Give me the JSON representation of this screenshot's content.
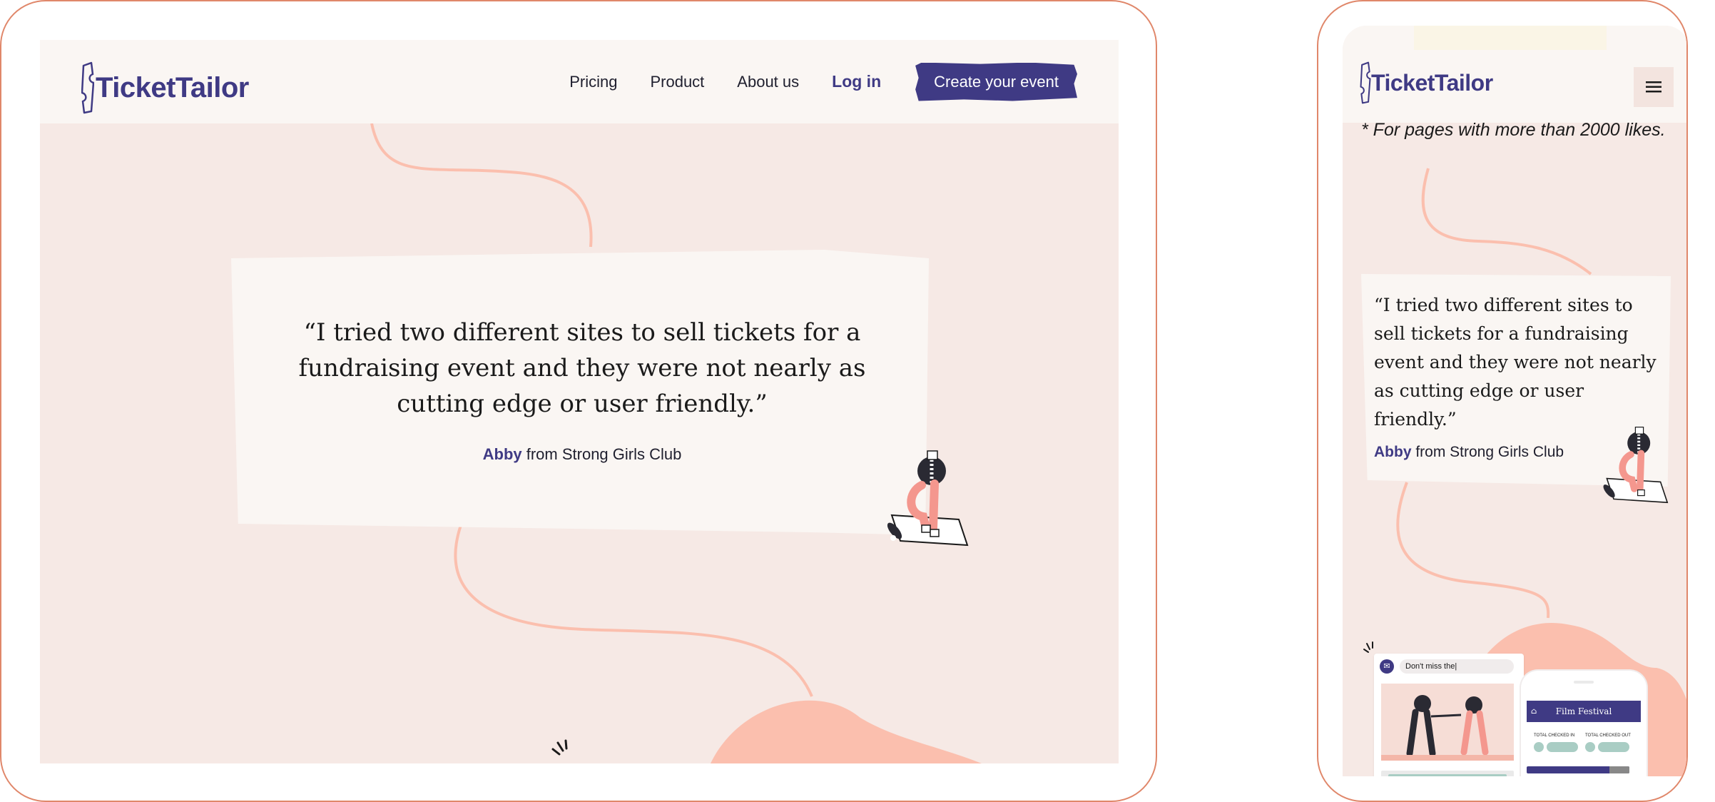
{
  "brand": {
    "name": "TicketTailor",
    "primary_color": "#3f3a84",
    "accent_color": "#fbbfae",
    "background_color": "#f6e9e5",
    "frame_color": "#e0876a"
  },
  "desktop": {
    "nav": {
      "links": [
        "Pricing",
        "Product",
        "About us"
      ],
      "login": "Log in",
      "cta": "Create your event"
    },
    "testimonial": {
      "quote": "“I tried two different sites to sell tickets for a fundraising event and they were not nearly as cutting edge or user friendly.”",
      "author": "Abby",
      "org": " from Strong Girls Club"
    }
  },
  "mobile": {
    "menu_icon": "hamburger-icon",
    "footnote": "* For pages with more than 2000 likes.",
    "testimonial": {
      "quote": "“I tried two different sites to sell tickets for a fundraising event and they were not nearly as cutting edge or user friendly.”",
      "author": "Abby",
      "org": " from Strong Girls Club"
    },
    "email_mock": {
      "input_text": "Don't miss the|"
    },
    "phone_mock": {
      "title": "Film Festival",
      "checked_in_label": "TOTAL CHECKED IN",
      "checked_out_label": "TOTAL CHECKED OUT"
    }
  }
}
